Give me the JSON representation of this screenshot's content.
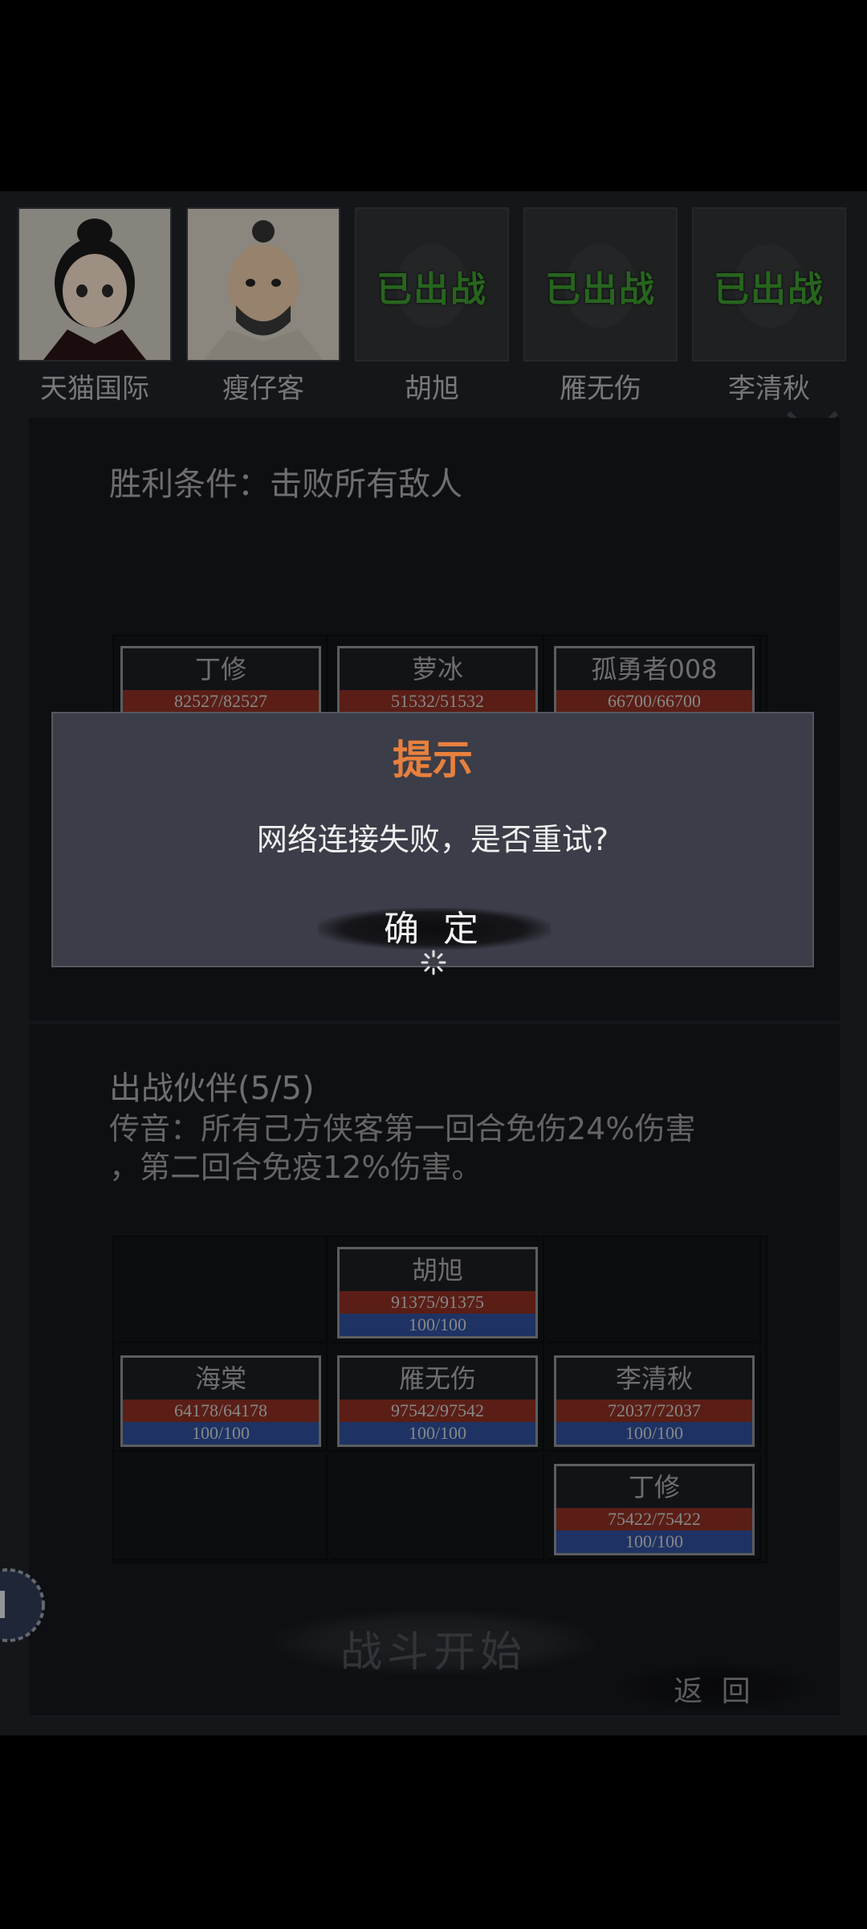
{
  "heroes": [
    {
      "name": "天猫国际",
      "status": ""
    },
    {
      "name": "瘦仔客",
      "status": ""
    },
    {
      "name": "胡旭",
      "status": "已出战"
    },
    {
      "name": "雁无伤",
      "status": "已出战"
    },
    {
      "name": "李清秋",
      "status": "已出战"
    }
  ],
  "enemy_section": {
    "victory_condition": "胜利条件：击败所有敌人",
    "units": [
      {
        "name": "丁修",
        "hp": "82527/82527"
      },
      {
        "name": "萝冰",
        "hp": "51532/51532"
      },
      {
        "name": "孤勇者008",
        "hp": "66700/66700"
      }
    ]
  },
  "dialog": {
    "title": "提示",
    "message": "网络连接失败，是否重试?",
    "confirm_label": "确 定"
  },
  "party_section": {
    "title": "出战伙伴(5/5)",
    "hint_line1": "传音：所有己方侠客第一回合免伤24%伤害",
    "hint_line2": "，第二回合免疫12%伤害。",
    "units": [
      {
        "name": "胡旭",
        "hp": "91375/91375",
        "mp": "100/100"
      },
      {
        "name": "海棠",
        "hp": "64178/64178",
        "mp": "100/100"
      },
      {
        "name": "雁无伤",
        "hp": "97542/97542",
        "mp": "100/100"
      },
      {
        "name": "李清秋",
        "hp": "72037/72037",
        "mp": "100/100"
      },
      {
        "name": "丁修",
        "hp": "75422/75422",
        "mp": "100/100"
      }
    ]
  },
  "buttons": {
    "start_battle": "战斗开始",
    "back": "返 回"
  },
  "colors": {
    "accent_title": "#e7803e",
    "deployed_green": "#3c9a2e",
    "hp_bar": "#8a2e22",
    "mp_bar": "#2f4f9a"
  }
}
